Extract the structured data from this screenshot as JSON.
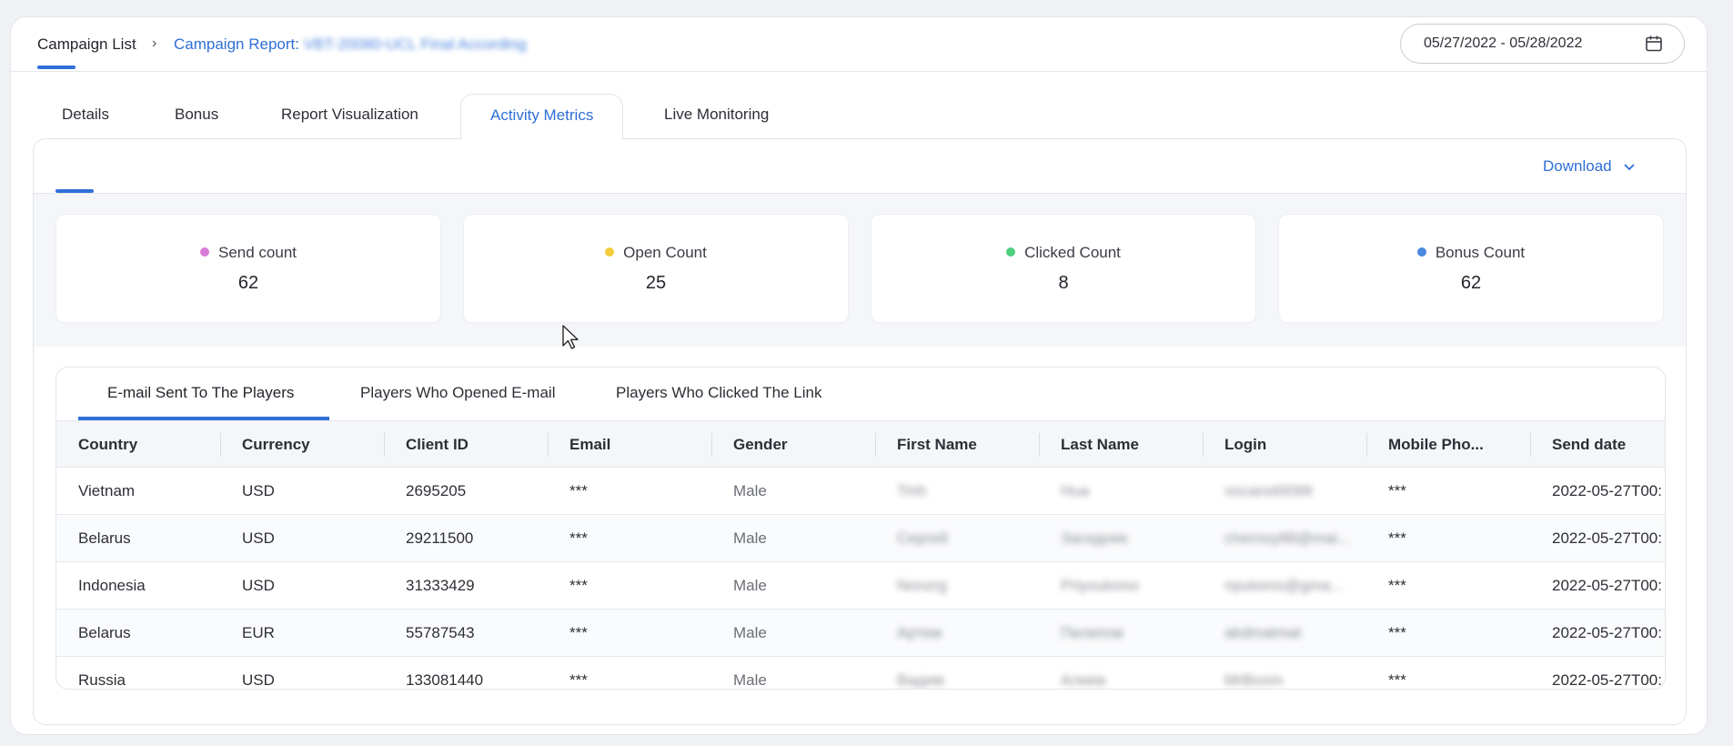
{
  "breadcrumb": {
    "home": "Campaign List",
    "separator": "›",
    "current_prefix": "Campaign Report: ",
    "current_blurred": "VBT-20080-UCL Final According"
  },
  "date_range": {
    "value": "05/27/2022 - 05/28/2022",
    "icon": "calendar-icon"
  },
  "tabs": [
    {
      "label": "Details",
      "active": false
    },
    {
      "label": "Bonus",
      "active": false
    },
    {
      "label": "Report Visualization",
      "active": false
    },
    {
      "label": "Activity Metrics",
      "active": true
    },
    {
      "label": "Live Monitoring",
      "active": false
    }
  ],
  "download": {
    "label": "Download",
    "icon": "chevron-down-icon"
  },
  "metrics": [
    {
      "label": "Send count",
      "value": "62",
      "color": "#d87ad8"
    },
    {
      "label": "Open Count",
      "value": "25",
      "color": "#f5cc3c"
    },
    {
      "label": "Clicked Count",
      "value": "8",
      "color": "#4fcf7f"
    },
    {
      "label": "Bonus Count",
      "value": "62",
      "color": "#4a8ae0"
    }
  ],
  "table_tabs": [
    {
      "label": "E-mail Sent To The Players",
      "active": true
    },
    {
      "label": "Players Who Opened E-mail",
      "active": false
    },
    {
      "label": "Players Who Clicked The Link",
      "active": false
    }
  ],
  "columns": [
    "Country",
    "Currency",
    "Client ID",
    "Email",
    "Gender",
    "First Name",
    "Last Name",
    "Login",
    "Mobile Pho...",
    "Send date"
  ],
  "rows": [
    {
      "country": "Vietnam",
      "currency": "USD",
      "client_id": "2695205",
      "email": "***",
      "gender": "Male",
      "first_name": "Tinh",
      "last_name": "Hua",
      "login": "vocanst0099",
      "mobile": "***",
      "send_date": "2022-05-27T00:"
    },
    {
      "country": "Belarus",
      "currency": "USD",
      "client_id": "29211500",
      "email": "***",
      "gender": "Male",
      "first_name": "Сергей",
      "last_name": "Заседник",
      "login": "chernoy88@mai...",
      "mobile": "***",
      "send_date": "2022-05-27T00:"
    },
    {
      "country": "Indonesia",
      "currency": "USD",
      "client_id": "31333429",
      "email": "***",
      "gender": "Male",
      "first_name": "Nonzrg",
      "last_name": "Priyoutomo",
      "login": "nputomo@gma...",
      "mobile": "***",
      "send_date": "2022-05-27T00:"
    },
    {
      "country": "Belarus",
      "currency": "EUR",
      "client_id": "55787543",
      "email": "***",
      "gender": "Male",
      "first_name": "Артем",
      "last_name": "Пилипов",
      "login": "akdmatmat",
      "mobile": "***",
      "send_date": "2022-05-27T00:"
    },
    {
      "country": "Russia",
      "currency": "USD",
      "client_id": "133081440",
      "email": "***",
      "gender": "Male",
      "first_name": "Вадим",
      "last_name": "Алиев",
      "login": "MrBoom",
      "mobile": "***",
      "send_date": "2022-05-27T00:"
    }
  ]
}
